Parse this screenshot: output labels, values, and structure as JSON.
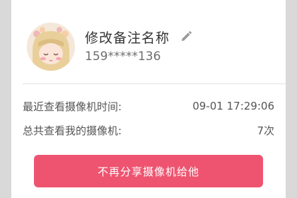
{
  "contact": {
    "name": "修改备注名称",
    "phone": "159*****136",
    "avatar_icon": "avatar-girl-illustration",
    "edit_icon": "pencil-icon"
  },
  "stats": {
    "last_view_label": "最近查看摄像机时间:",
    "last_view_value": "09-01 17:29:06",
    "total_label": "总共查看我的摄像机:",
    "total_value": "7次"
  },
  "actions": {
    "stop_share_label": "不再分享摄像机给他"
  },
  "colors": {
    "accent": "#ee5470",
    "background": "#d9d9d9",
    "card": "#ffffff",
    "text_primary": "#333333",
    "text_secondary": "#6e6e6e"
  }
}
